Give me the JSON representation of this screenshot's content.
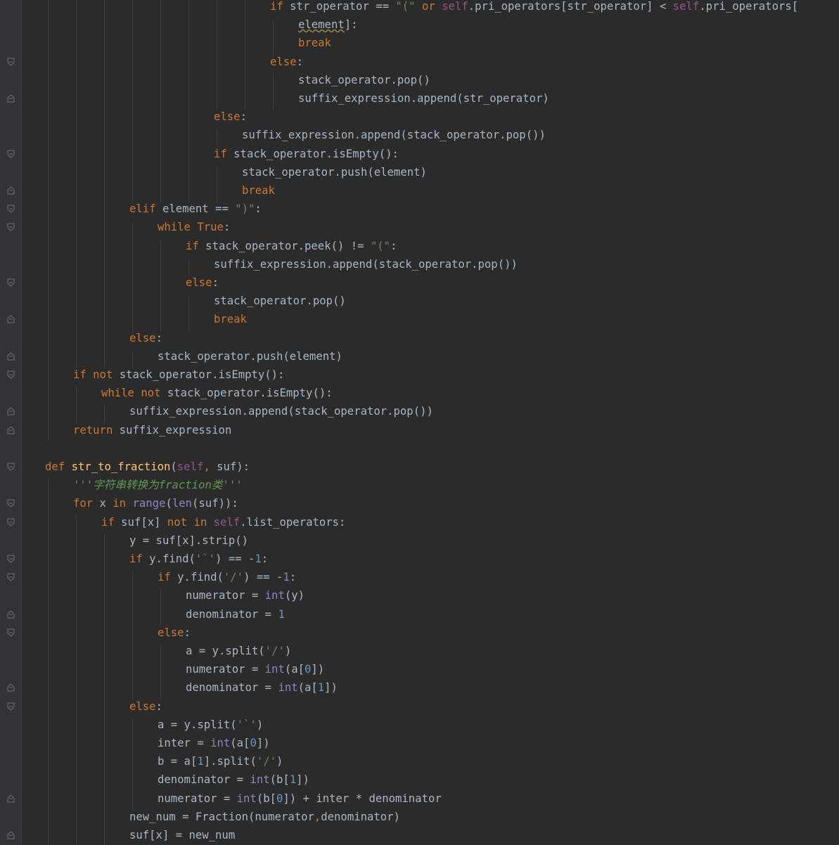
{
  "editor": {
    "language": "python",
    "theme_colors": {
      "background": "#2b2b2b",
      "gutter": "#313335",
      "keyword": "#cc7832",
      "string": "#6a8759",
      "number": "#6897bb",
      "self": "#94558d",
      "function_name": "#ffc66d",
      "builtin": "#8888c6",
      "text": "#a9b7c6",
      "docstring": "#629755"
    },
    "lines": [
      {
        "indent": 9,
        "tokens": [
          [
            "kw",
            "if"
          ],
          [
            "plain",
            " str_operator == "
          ],
          [
            "str",
            "\"(\""
          ],
          [
            "plain",
            " "
          ],
          [
            "kw",
            "or"
          ],
          [
            "plain",
            " "
          ],
          [
            "slf",
            "self"
          ],
          [
            "plain",
            ".pri_operators[str_operator] < "
          ],
          [
            "slf",
            "self"
          ],
          [
            "plain",
            ".pri_operators["
          ]
        ]
      },
      {
        "indent": 10,
        "tokens": [
          [
            "uline",
            "element"
          ],
          [
            "plain",
            "]:"
          ]
        ]
      },
      {
        "indent": 10,
        "tokens": [
          [
            "kw",
            "break"
          ]
        ]
      },
      {
        "indent": 9,
        "tokens": [
          [
            "kw",
            "else"
          ],
          [
            "plain",
            ":"
          ]
        ]
      },
      {
        "indent": 10,
        "tokens": [
          [
            "plain",
            "stack_operator.pop()"
          ]
        ]
      },
      {
        "indent": 10,
        "tokens": [
          [
            "plain",
            "suffix_expression.append(str_operator)"
          ]
        ]
      },
      {
        "indent": 7,
        "tokens": [
          [
            "kw",
            "else"
          ],
          [
            "plain",
            ":"
          ]
        ]
      },
      {
        "indent": 8,
        "tokens": [
          [
            "plain",
            "suffix_expression.append(stack_operator.pop())"
          ]
        ]
      },
      {
        "indent": 7,
        "tokens": [
          [
            "kw",
            "if"
          ],
          [
            "plain",
            " stack_operator.isEmpty():"
          ]
        ]
      },
      {
        "indent": 8,
        "tokens": [
          [
            "plain",
            "stack_operator.push(element)"
          ]
        ]
      },
      {
        "indent": 8,
        "tokens": [
          [
            "kw",
            "break"
          ]
        ]
      },
      {
        "indent": 4,
        "tokens": [
          [
            "kw",
            "elif"
          ],
          [
            "plain",
            " element == "
          ],
          [
            "str",
            "\")\""
          ],
          [
            "plain",
            ":"
          ]
        ]
      },
      {
        "indent": 5,
        "tokens": [
          [
            "kw",
            "while"
          ],
          [
            "plain",
            " "
          ],
          [
            "kw",
            "True"
          ],
          [
            "plain",
            ":"
          ]
        ]
      },
      {
        "indent": 6,
        "tokens": [
          [
            "kw",
            "if"
          ],
          [
            "plain",
            " stack_operator.peek() != "
          ],
          [
            "str",
            "\"(\""
          ],
          [
            "plain",
            ":"
          ]
        ]
      },
      {
        "indent": 7,
        "tokens": [
          [
            "plain",
            "suffix_expression.append(stack_operator.pop())"
          ]
        ]
      },
      {
        "indent": 6,
        "tokens": [
          [
            "kw",
            "else"
          ],
          [
            "plain",
            ":"
          ]
        ]
      },
      {
        "indent": 7,
        "tokens": [
          [
            "plain",
            "stack_operator.pop()"
          ]
        ]
      },
      {
        "indent": 7,
        "tokens": [
          [
            "kw",
            "break"
          ]
        ]
      },
      {
        "indent": 4,
        "tokens": [
          [
            "kw",
            "else"
          ],
          [
            "plain",
            ":"
          ]
        ]
      },
      {
        "indent": 5,
        "tokens": [
          [
            "plain",
            "stack_operator.push(element)"
          ]
        ]
      },
      {
        "indent": 2,
        "tokens": [
          [
            "kw",
            "if"
          ],
          [
            "plain",
            " "
          ],
          [
            "kw",
            "not"
          ],
          [
            "plain",
            " stack_operator.isEmpty():"
          ]
        ]
      },
      {
        "indent": 3,
        "tokens": [
          [
            "kw",
            "while"
          ],
          [
            "plain",
            " "
          ],
          [
            "kw",
            "not"
          ],
          [
            "plain",
            " stack_operator.isEmpty():"
          ]
        ]
      },
      {
        "indent": 4,
        "tokens": [
          [
            "plain",
            "suffix_expression.append(stack_operator.pop())"
          ]
        ]
      },
      {
        "indent": 2,
        "tokens": [
          [
            "kw",
            "return"
          ],
          [
            "plain",
            " suffix_expression"
          ]
        ]
      },
      {
        "indent": 0,
        "tokens": []
      },
      {
        "indent": 1,
        "tokens": [
          [
            "kw",
            "def"
          ],
          [
            "plain",
            " "
          ],
          [
            "fn",
            "str_to_fraction"
          ],
          [
            "plain",
            "("
          ],
          [
            "slf",
            "self"
          ],
          [
            "kw",
            ","
          ],
          [
            "plain",
            " suf):"
          ]
        ]
      },
      {
        "indent": 2,
        "tokens": [
          [
            "doc",
            "'''字符串转换为fraction类'''"
          ]
        ]
      },
      {
        "indent": 2,
        "tokens": [
          [
            "kw",
            "for"
          ],
          [
            "plain",
            " x "
          ],
          [
            "kw",
            "in"
          ],
          [
            "plain",
            " "
          ],
          [
            "bi",
            "range"
          ],
          [
            "plain",
            "("
          ],
          [
            "bi",
            "len"
          ],
          [
            "plain",
            "(suf)):"
          ]
        ]
      },
      {
        "indent": 3,
        "tokens": [
          [
            "kw",
            "if"
          ],
          [
            "plain",
            " suf[x] "
          ],
          [
            "kw",
            "not in"
          ],
          [
            "plain",
            " "
          ],
          [
            "slf",
            "self"
          ],
          [
            "plain",
            ".list_operators:"
          ]
        ]
      },
      {
        "indent": 4,
        "tokens": [
          [
            "plain",
            "y = suf[x].strip()"
          ]
        ]
      },
      {
        "indent": 4,
        "tokens": [
          [
            "kw",
            "if"
          ],
          [
            "plain",
            " y.find("
          ],
          [
            "str",
            "'`'"
          ],
          [
            "plain",
            ") == -"
          ],
          [
            "num",
            "1"
          ],
          [
            "plain",
            ":"
          ]
        ]
      },
      {
        "indent": 5,
        "tokens": [
          [
            "kw",
            "if"
          ],
          [
            "plain",
            " y.find("
          ],
          [
            "str",
            "'/'"
          ],
          [
            "plain",
            ") == -"
          ],
          [
            "num",
            "1"
          ],
          [
            "plain",
            ":"
          ]
        ]
      },
      {
        "indent": 6,
        "tokens": [
          [
            "plain",
            "numerator = "
          ],
          [
            "bi",
            "int"
          ],
          [
            "plain",
            "(y)"
          ]
        ]
      },
      {
        "indent": 6,
        "tokens": [
          [
            "plain",
            "denominator = "
          ],
          [
            "num",
            "1"
          ]
        ]
      },
      {
        "indent": 5,
        "tokens": [
          [
            "kw",
            "else"
          ],
          [
            "plain",
            ":"
          ]
        ]
      },
      {
        "indent": 6,
        "tokens": [
          [
            "plain",
            "a = y.split("
          ],
          [
            "str",
            "'/'"
          ],
          [
            "plain",
            ")"
          ]
        ]
      },
      {
        "indent": 6,
        "tokens": [
          [
            "plain",
            "numerator = "
          ],
          [
            "bi",
            "int"
          ],
          [
            "plain",
            "(a["
          ],
          [
            "num",
            "0"
          ],
          [
            "plain",
            "])"
          ]
        ]
      },
      {
        "indent": 6,
        "tokens": [
          [
            "plain",
            "denominator = "
          ],
          [
            "bi",
            "int"
          ],
          [
            "plain",
            "(a["
          ],
          [
            "num",
            "1"
          ],
          [
            "plain",
            "])"
          ]
        ]
      },
      {
        "indent": 4,
        "tokens": [
          [
            "kw",
            "else"
          ],
          [
            "plain",
            ":"
          ]
        ]
      },
      {
        "indent": 5,
        "tokens": [
          [
            "plain",
            "a = y.split("
          ],
          [
            "str",
            "'`'"
          ],
          [
            "plain",
            ")"
          ]
        ]
      },
      {
        "indent": 5,
        "tokens": [
          [
            "plain",
            "inter = "
          ],
          [
            "bi",
            "int"
          ],
          [
            "plain",
            "(a["
          ],
          [
            "num",
            "0"
          ],
          [
            "plain",
            "])"
          ]
        ]
      },
      {
        "indent": 5,
        "tokens": [
          [
            "plain",
            "b = a["
          ],
          [
            "num",
            "1"
          ],
          [
            "plain",
            "].split("
          ],
          [
            "str",
            "'/'"
          ],
          [
            "plain",
            ")"
          ]
        ]
      },
      {
        "indent": 5,
        "tokens": [
          [
            "plain",
            "denominator = "
          ],
          [
            "bi",
            "int"
          ],
          [
            "plain",
            "(b["
          ],
          [
            "num",
            "1"
          ],
          [
            "plain",
            "])"
          ]
        ]
      },
      {
        "indent": 5,
        "tokens": [
          [
            "plain",
            "numerator = "
          ],
          [
            "bi",
            "int"
          ],
          [
            "plain",
            "(b["
          ],
          [
            "num",
            "0"
          ],
          [
            "plain",
            "]) + inter * denominator"
          ]
        ]
      },
      {
        "indent": 4,
        "tokens": [
          [
            "plain",
            "new_num = Fraction(numerator"
          ],
          [
            "kw",
            ","
          ],
          [
            "plain",
            "denominator)"
          ]
        ]
      },
      {
        "indent": 4,
        "tokens": [
          [
            "plain",
            "suf[x] = new_num"
          ]
        ]
      }
    ],
    "fold_markers": [
      {
        "line": 3,
        "kind": "open"
      },
      {
        "line": 5,
        "kind": "close"
      },
      {
        "line": 8,
        "kind": "open"
      },
      {
        "line": 10,
        "kind": "close"
      },
      {
        "line": 11,
        "kind": "open"
      },
      {
        "line": 12,
        "kind": "open"
      },
      {
        "line": 15,
        "kind": "open"
      },
      {
        "line": 17,
        "kind": "close"
      },
      {
        "line": 19,
        "kind": "close"
      },
      {
        "line": 20,
        "kind": "open"
      },
      {
        "line": 22,
        "kind": "close"
      },
      {
        "line": 23,
        "kind": "close"
      },
      {
        "line": 25,
        "kind": "open"
      },
      {
        "line": 27,
        "kind": "open"
      },
      {
        "line": 28,
        "kind": "open"
      },
      {
        "line": 30,
        "kind": "open"
      },
      {
        "line": 31,
        "kind": "open"
      },
      {
        "line": 33,
        "kind": "close"
      },
      {
        "line": 34,
        "kind": "open"
      },
      {
        "line": 37,
        "kind": "close"
      },
      {
        "line": 38,
        "kind": "open"
      },
      {
        "line": 43,
        "kind": "close"
      },
      {
        "line": 45,
        "kind": "close"
      }
    ]
  }
}
